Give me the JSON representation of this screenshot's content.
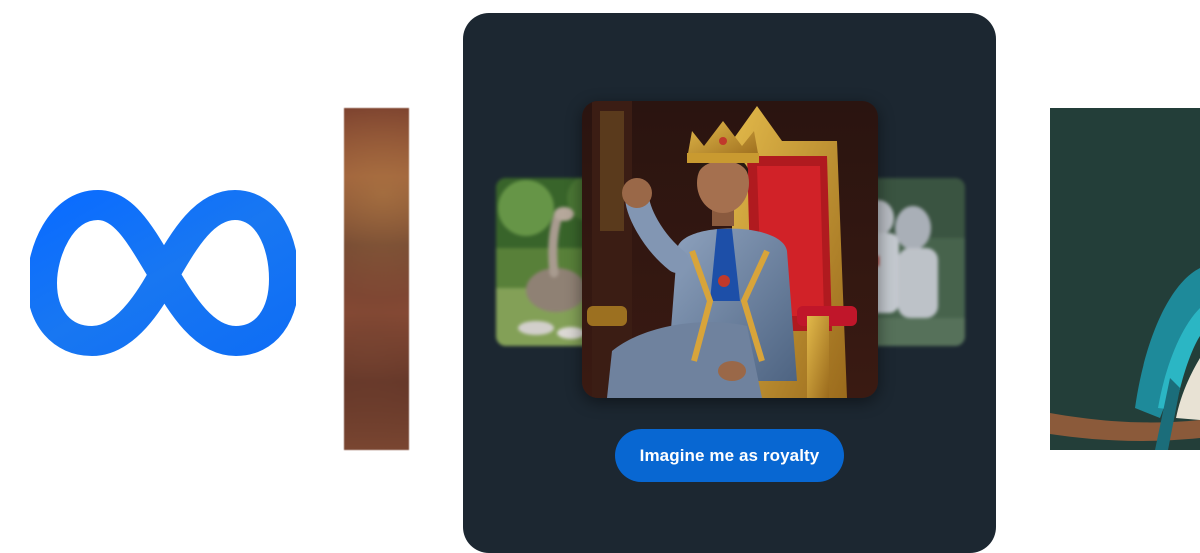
{
  "brand": {
    "logo": "meta-infinity-logo",
    "accent_color": "#0866FF"
  },
  "carousel": {
    "panel_color": "#1C2731",
    "images": {
      "left_strip": "blurred-photo",
      "left_thumb": "ostrich-photo",
      "main": "king-on-throne-photo",
      "right_thumb": "astronaut-photo",
      "right_strip": "bird-on-branch-photo"
    },
    "prompt_button": {
      "label": "Imagine me as royalty",
      "color": "#0867D2"
    }
  }
}
